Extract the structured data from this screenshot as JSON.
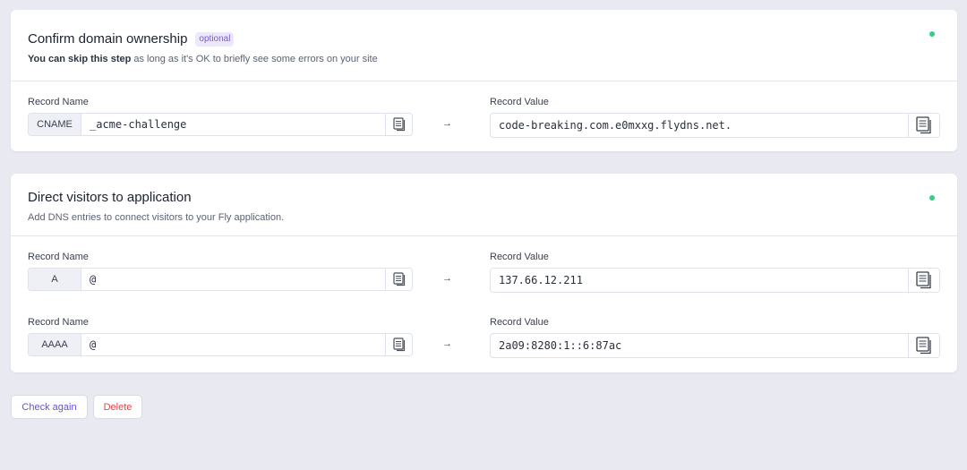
{
  "sections": [
    {
      "title": "Confirm domain ownership",
      "badge": "optional",
      "subtitle_bold": "You can skip this step",
      "subtitle_rest": " as long as it's OK to briefly see some errors on your site",
      "records": [
        {
          "name_label": "Record Name",
          "type": "CNAME",
          "name": "_acme-challenge",
          "arrow": "→",
          "value_label": "Record Value",
          "value": "code-breaking.com.e0mxxg.flydns.net."
        }
      ]
    },
    {
      "title": "Direct visitors to application",
      "subtitle": "Add DNS entries to connect visitors to your Fly application.",
      "records": [
        {
          "name_label": "Record Name",
          "type": "A",
          "name": "@",
          "arrow": "→",
          "value_label": "Record Value",
          "value": "137.66.12.211"
        },
        {
          "name_label": "Record Name",
          "type": "AAAA",
          "name": "@",
          "arrow": "→",
          "value_label": "Record Value",
          "value": "2a09:8280:1::6:87ac"
        }
      ]
    }
  ],
  "actions": {
    "check_again": "Check again",
    "delete": "Delete"
  },
  "colors": {
    "status_ok": "#35d07f",
    "badge_text": "#7a5bd6",
    "primary": "#6b4fd8",
    "danger": "#e0454a"
  },
  "icons": {
    "copy": "clipboard-copy-icon"
  }
}
